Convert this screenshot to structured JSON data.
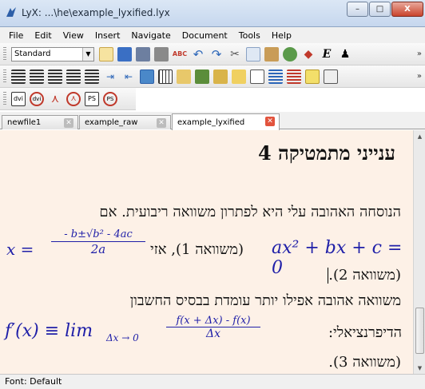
{
  "window": {
    "title": "LyX: ...\\he\\example_lyxified.lyx",
    "minimize": "–",
    "maximize": "□",
    "close": "X"
  },
  "menu": [
    "File",
    "Edit",
    "View",
    "Insert",
    "Navigate",
    "Document",
    "Tools",
    "Help"
  ],
  "toolbar": {
    "style_value": "Standard"
  },
  "toolbar3_icons": [
    "dvi",
    "dvi",
    "pdf",
    "pdf",
    "PS",
    "PS"
  ],
  "tabs": [
    {
      "label": "newfile1"
    },
    {
      "label": "example_raw"
    },
    {
      "label": "example_lyxified"
    }
  ],
  "document": {
    "heading_number": "4",
    "heading_text": "ענייני מתמטיקה",
    "para1": "הנוסחה האהובה עלי היא לפתרון משוואה ריבועית. אם",
    "eq1_left": "ax² + bx + c = 0",
    "eq1_middle": "(משוואה 1), אזי",
    "eq1_x": "x =",
    "eq1_num": "- b±√b² - 4ac",
    "eq1_den": "2a",
    "eq1_ref2": "(משוואה 2).",
    "para2": "משוואה אהובה אפילו יותר עומדת בבסיס החשבון",
    "para2b": "הדיפרנציאלי:",
    "eq2_lhs": "f′(x) ≡ lim",
    "eq2_sub": "Δx → 0",
    "eq2_num": "f(x + Δx) - f(x)",
    "eq2_den": "Δx",
    "eq2_ref3": "(משוואה 3)."
  },
  "status": "Font: Default",
  "colors": {
    "math": "#1f1fa8",
    "doc_bg": "#fdf1e7",
    "tab_close_active": "#e2533d"
  }
}
